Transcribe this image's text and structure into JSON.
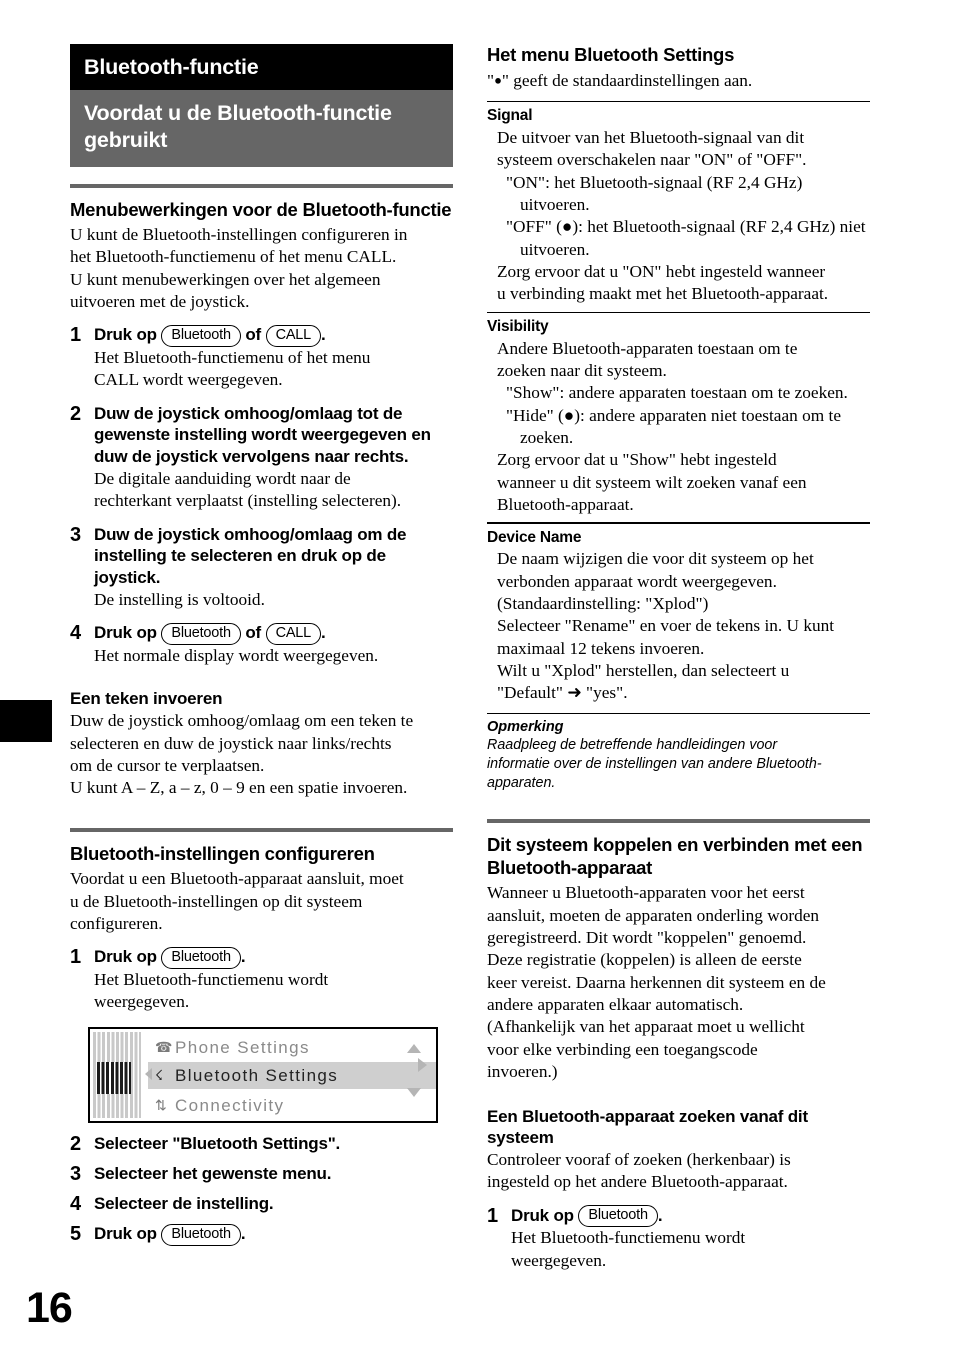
{
  "page": {
    "number": "16"
  },
  "chapter": {
    "banner_black": "Bluetooth-functie",
    "banner_grey": "Voordat u de Bluetooth-functie gebruikt"
  },
  "left_column": {
    "section_menu_ops": {
      "heading": "Menubewerkingen voor de Bluetooth-functie",
      "intro_line1": "U kunt de Bluetooth-instellingen configureren in",
      "intro_line2": "het Bluetooth-functiemenu of het menu CALL.",
      "intro_line3": "U kunt menubewerkingen over het algemeen",
      "intro_line4": "uitvoeren met de joystick.",
      "steps": [
        {
          "num": "1",
          "title_prefix": "Druk op",
          "button1": "Bluetooth",
          "conjunction": "of",
          "button2": "CALL",
          "title_suffix": ".",
          "desc_line1": "Het Bluetooth-functiemenu of het menu",
          "desc_line2": "CALL wordt weergegeven."
        },
        {
          "num": "2",
          "title": "Duw de joystick omhoog/omlaag tot de gewenste instelling wordt weergegeven en duw de joystick vervolgens naar rechts.",
          "desc_line1": "De digitale aanduiding wordt naar de",
          "desc_line2": "rechterkant verplaatst (instelling selecteren)."
        },
        {
          "num": "3",
          "title": "Duw de joystick omhoog/omlaag om de instelling te selecteren en druk op de joystick.",
          "desc_line1": "De instelling is voltooid."
        },
        {
          "num": "4",
          "title_prefix": "Druk op",
          "button1": "Bluetooth",
          "conjunction": "of",
          "button2": "CALL",
          "title_suffix": ".",
          "desc_line1": "Het normale display wordt weergegeven."
        }
      ]
    },
    "section_character": {
      "heading": "Een teken invoeren",
      "line1": "Duw de joystick omhoog/omlaag om een teken te",
      "line2": "selecteren en duw de joystick naar links/rechts",
      "line3": "om de cursor te verplaatsen.",
      "line4": "U kunt A – Z, a – z, 0 – 9 en een spatie invoeren."
    },
    "section_configure": {
      "heading": "Bluetooth-instellingen configureren",
      "intro_line1": "Voordat u een Bluetooth-apparaat aansluit, moet",
      "intro_line2": "u de Bluetooth-instellingen op dit systeem",
      "intro_line3": "configureren.",
      "step1": {
        "num": "1",
        "title_prefix": "Druk op",
        "button1": "Bluetooth",
        "title_suffix": ".",
        "desc_line1": "Het Bluetooth-functiemenu wordt",
        "desc_line2": "weergegeven."
      },
      "lcd": {
        "line1_icon": "phone-icon",
        "line1_text": "Phone Settings",
        "line2_icon": "bluetooth-icon",
        "line2_text": "Bluetooth Settings",
        "line3_icon": "connectivity-icon",
        "line3_text": "Connectivity"
      },
      "steps_rest": [
        {
          "num": "2",
          "title": "Selecteer \"Bluetooth Settings\"."
        },
        {
          "num": "3",
          "title": "Selecteer het gewenste menu."
        },
        {
          "num": "4",
          "title": "Selecteer de instelling."
        }
      ],
      "step5": {
        "num": "5",
        "title_prefix": "Druk op",
        "button1": "Bluetooth",
        "title_suffix": "."
      }
    }
  },
  "right_column": {
    "section_settings_menu": {
      "heading": "Het menu Bluetooth Settings",
      "subtitle_pre": "\"",
      "subtitle_post": "\" geeft de standaardinstellingen aan.",
      "items": [
        {
          "name": "Signal",
          "lines": [
            "De uitvoer van het Bluetooth-signaal van dit",
            "systeem overschakelen naar \"ON\" of \"OFF\"."
          ],
          "dashes": [
            "\"ON\": het Bluetooth-signaal (RF 2,4 GHz) uitvoeren.",
            "\"OFF\" (●): het Bluetooth-signaal (RF 2,4 GHz) niet uitvoeren."
          ],
          "tail": [
            "Zorg ervoor dat u \"ON\" hebt ingesteld wanneer",
            "u verbinding maakt met het Bluetooth-apparaat."
          ]
        },
        {
          "name": "Visibility",
          "lines": [
            "Andere Bluetooth-apparaten toestaan om te",
            "zoeken naar dit systeem."
          ],
          "dashes": [
            "\"Show\": andere apparaten toestaan om te zoeken.",
            "\"Hide\" (●): andere apparaten niet toestaan om te zoeken."
          ],
          "tail": [
            "Zorg ervoor dat u \"Show\" hebt ingesteld",
            "wanneer u dit systeem wilt zoeken vanaf een",
            "Bluetooth-apparaat."
          ]
        },
        {
          "name": "Device Name",
          "lines": [
            "De naam wijzigen die voor dit systeem op het",
            "verbonden apparaat wordt weergegeven.",
            "(Standaardinstelling: \"Xplod\")",
            "Selecteer \"Rename\" en voer de tekens in. U kunt",
            "maximaal 12 tekens invoeren.",
            "Wilt u \"Xplod\" herstellen, dan selecteert u",
            "\"Default\" ➜ \"yes\"."
          ],
          "dashes": [],
          "tail": []
        }
      ]
    },
    "note": {
      "title": "Opmerking",
      "line1": "Raadpleeg de betreffende handleidingen voor",
      "line2": "informatie over de instellingen van andere Bluetooth-",
      "line3": "apparaten."
    },
    "section_pairing": {
      "heading": "Dit systeem koppelen en verbinden met een Bluetooth-apparaat",
      "lines": [
        "Wanneer u Bluetooth-apparaten voor het eerst",
        "aansluit, moeten de apparaten onderling worden",
        "geregistreerd. Dit wordt \"koppelen\" genoemd.",
        "Deze registratie (koppelen) is alleen de eerste",
        "keer vereist. Daarna herkennen dit systeem en de",
        "andere apparaten elkaar automatisch.",
        "(Afhankelijk van het apparaat moet u wellicht",
        "voor elke verbinding een toegangscode",
        "invoeren.)"
      ]
    },
    "section_search": {
      "heading": "Een Bluetooth-apparaat zoeken vanaf dit systeem",
      "lines": [
        "Controleer vooraf of zoeken (herkenbaar) is",
        "ingesteld op het andere Bluetooth-apparaat."
      ],
      "step1": {
        "num": "1",
        "title_prefix": "Druk op",
        "button1": "Bluetooth",
        "title_suffix": ".",
        "desc_line1": "Het Bluetooth-functiemenu wordt",
        "desc_line2": "weergegeven."
      }
    }
  },
  "colors": {
    "banner_black": "#000000",
    "banner_grey": "#666666",
    "rule_grey": "#666666",
    "lcd_highlight": "#cfcfcf"
  }
}
